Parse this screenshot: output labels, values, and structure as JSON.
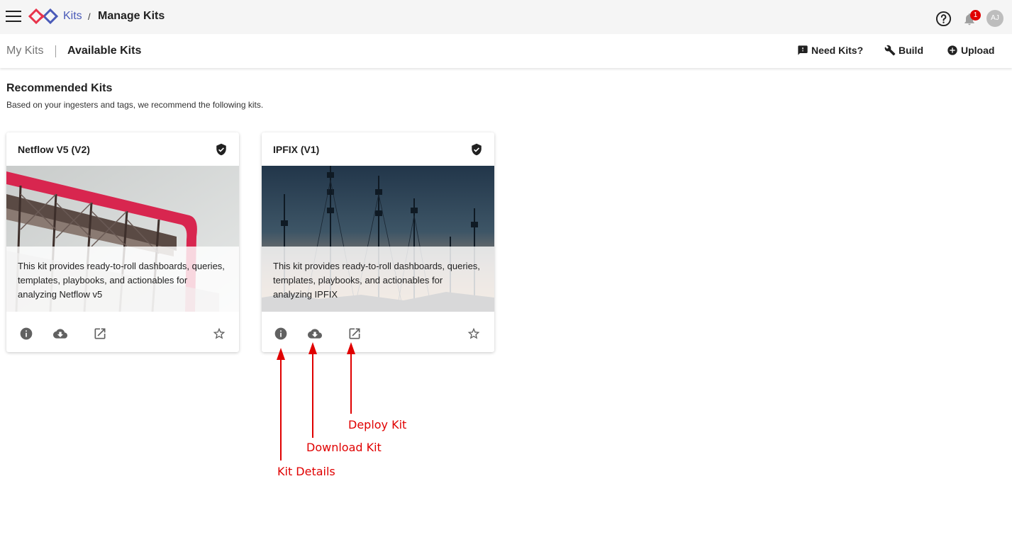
{
  "header": {
    "breadcrumb_root": "Kits",
    "breadcrumb_sep": "/",
    "title": "Manage Kits",
    "notification_count": "1",
    "avatar_initials": "AJ",
    "accent_color": "#4a5ab8",
    "badge_color": "#e00000"
  },
  "subnav": {
    "tabs": [
      {
        "label": "My Kits",
        "active": false
      },
      {
        "label": "Available Kits",
        "active": true
      }
    ],
    "actions": [
      {
        "label": "Need Kits?",
        "icon": "feedback-icon"
      },
      {
        "label": "Build",
        "icon": "wrench-icon"
      },
      {
        "label": "Upload",
        "icon": "add-circle-icon"
      }
    ]
  },
  "section": {
    "title": "Recommended Kits",
    "subtitle": "Based on your ingesters and tags, we recommend the following kits."
  },
  "kits": [
    {
      "title": "Netflow V5 (V2)",
      "image": "pipeline-photo",
      "description": "This kit provides ready-to-roll dashboards, queries, templates, playbooks, and actionables for analyzing Netflow v5",
      "verified": true
    },
    {
      "title": "IPFIX (V1)",
      "image": "radio-towers-photo",
      "description": "This kit provides ready-to-roll dashboards, queries, templates, playbooks, and actionables for analyzing IPFIX",
      "verified": true
    }
  ],
  "card_actions": [
    "info-icon",
    "cloud-download-icon",
    "open-in-new-icon",
    "star-outline-icon"
  ],
  "annotations": {
    "color": "#e00000",
    "kit_details": "Kit Details",
    "download_kit": "Download Kit",
    "deploy_kit": "Deploy Kit"
  }
}
